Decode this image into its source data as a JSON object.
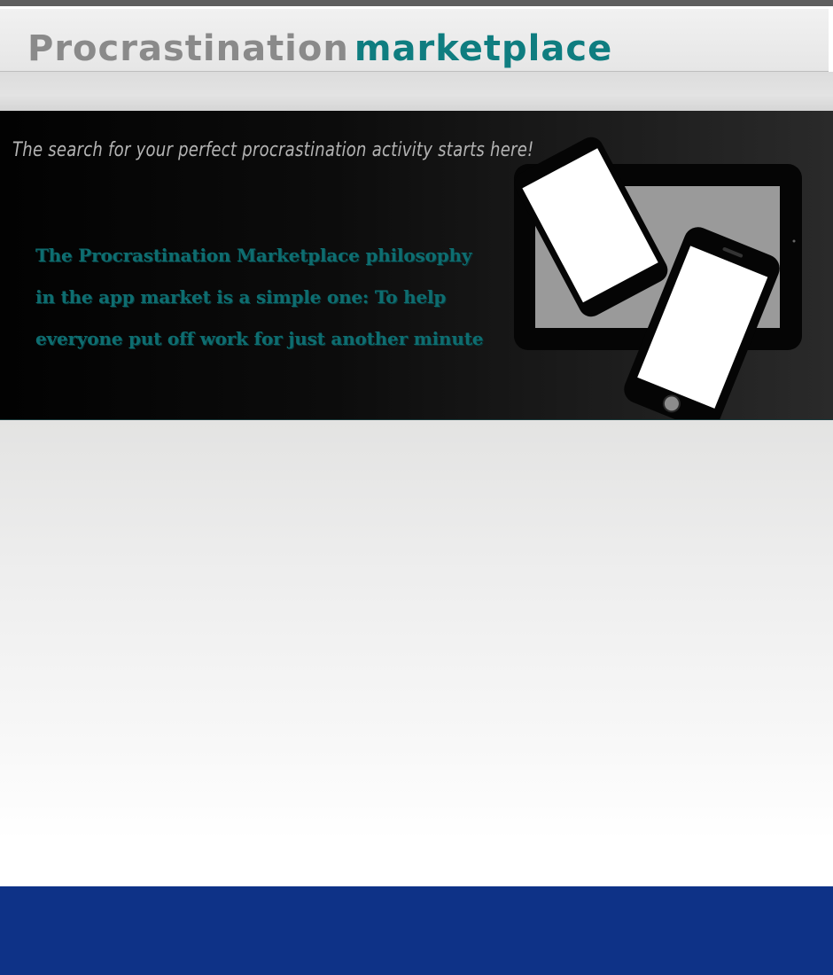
{
  "header": {
    "brand_part1": "Procrastination",
    "brand_part2": "marketplace"
  },
  "hero": {
    "tagline": "The search for your perfect procrastination activity starts here!",
    "philosophy": "The Procrastination Marketplace philosophy in the app market  is a simple one: To help everyone put off work for just another minute"
  },
  "colors": {
    "brand_gray": "#8a8a8a",
    "brand_teal": "#0f7d80",
    "footer_blue": "#0e3287"
  },
  "icons": {
    "hero_image": "devices-illustration"
  }
}
